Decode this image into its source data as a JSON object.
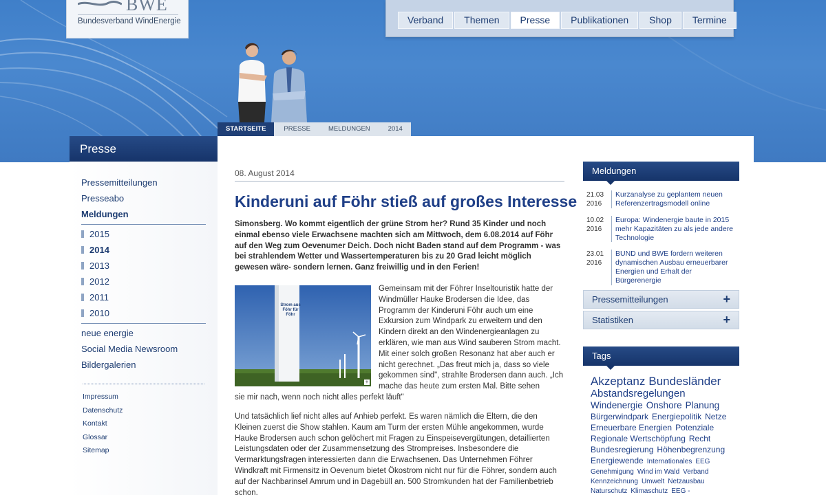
{
  "logo": {
    "word": "BWE",
    "tagline": "Bundesverband WindEnergie"
  },
  "topnav": [
    "Verband",
    "Themen",
    "Presse",
    "Publikationen",
    "Shop",
    "Termine"
  ],
  "breadcrumb": [
    "STARTSEITE",
    "PRESSE",
    "MELDUNGEN",
    "2014"
  ],
  "left": {
    "section_title": "Presse",
    "items": [
      "Pressemitteilungen",
      "Presseabo",
      "Meldungen"
    ],
    "years": [
      "2015",
      "2014",
      "2013",
      "2012",
      "2011",
      "2010"
    ],
    "more_items": [
      "neue energie",
      "Social Media Newsroom",
      "Bildergalerien"
    ],
    "footer_links": [
      "Impressum",
      "Datenschutz",
      "Kontakt",
      "Glossar",
      "Sitemap"
    ]
  },
  "article": {
    "date": "08. August 2014",
    "title": "Kinderuni auf Föhr stieß auf großes Interesse",
    "lead": "Simonsberg. Wo kommt eigentlich der grüne Strom her?  Rund 35 Kinder und noch einmal ebenso viele Erwachsene machten sich am Mittwoch, dem 6.08.2014 auf Föhr auf den Weg zum Oevenumer Deich. Doch nicht Baden stand auf dem Programm - was bei strahlendem Wetter und Wassertemperaturen bis zu 20 Grad leicht möglich gewesen wäre-  sondern lernen. Ganz freiwillig und in den Ferien!",
    "photo_tower_text": "Strom aus Föhr für Föhr",
    "para1": "Gemeinsam mit der Föhrer Inseltouristik hatte der Windmüller Hauke Brodersen die Idee, das Programm der Kinderuni Föhr auch um eine Exkursion zum Windpark zu erweitern und den Kindern direkt an den Windenergieanlagen zu erklären, wie man aus Wind sauberen Strom macht. Mit einer solch großen Resonanz hat aber auch er nicht gerechnet. „Das freut mich ja, dass so viele gekommen sind\", strahlte Brodersen dann auch. „Ich mache das heute zum ersten Mal. Bitte sehen",
    "para1_cont": "sie mir nach, wenn noch nicht alles perfekt läuft\"",
    "para2": "Und tatsächlich lief nicht alles auf Anhieb perfekt. Es waren nämlich die Eltern, die den Kleinen zuerst die Show stahlen. Kaum am Turm der ersten Mühle angekommen, wurde Hauke Brodersen auch schon gelöchert mit Fragen zu Einspeisevergütungen, detaillierten Leistungsdaten oder der Zusammensetzung des Strompreises. Insbesondere die Vermarktungsfragen interessierten dann die Erwachsenen. Das Unternehmen Föhrer Windkraft mit Firmensitz in Oevenum bietet Ökostrom nicht nur für die Föhrer, sondern auch auf der Nachbarinsel Amrum und in Dagebüll an. 500 Stromkunden hat der Familienbetrieb schon."
  },
  "meldungen": {
    "title": "Meldungen",
    "items": [
      {
        "d1": "21.03",
        "d2": "2016",
        "text": "Kurzanalyse zu geplantem neuen Referenzertragsmodell online"
      },
      {
        "d1": "10.02",
        "d2": "2016",
        "text": "Europa: Windenergie baute in 2015 mehr Kapazitäten zu als jede andere Technologie"
      },
      {
        "d1": "23.01",
        "d2": "2016",
        "text": "BUND und BWE fordern weiteren dynamischen Ausbau erneuerbarer Energien und Erhalt der Bürgerenergie"
      }
    ]
  },
  "accordions": [
    "Pressemitteilungen",
    "Statistiken"
  ],
  "tags_title": "Tags",
  "tags": [
    [
      "Akzeptanz",
      "Bundesländer"
    ],
    [
      "Abstandsregelungen"
    ],
    [
      "Windenergie",
      "Onshore",
      "Planung"
    ],
    [
      "Bürgerwindpark",
      "Energiepolitik",
      "Netze"
    ],
    [
      "Erneuerbare Energien",
      "Potenziale"
    ],
    [
      "Regionale Wertschöpfung",
      "Recht"
    ],
    [
      "Bundesregierung",
      "Höhenbegrenzung"
    ],
    [
      "Energiewende",
      "Internationales",
      "EEG"
    ],
    [
      "Genehmigung",
      "Wind im Wald",
      "Verband"
    ],
    [
      "Kennzeichnung",
      "Umwelt",
      "Netzausbau"
    ],
    [
      "Naturschutz",
      "Klimaschutz",
      "EEG -"
    ]
  ],
  "colors": {
    "navy": "#1f3f87",
    "header_blue": "#4a88cf",
    "dark_bar": "#16346a"
  }
}
